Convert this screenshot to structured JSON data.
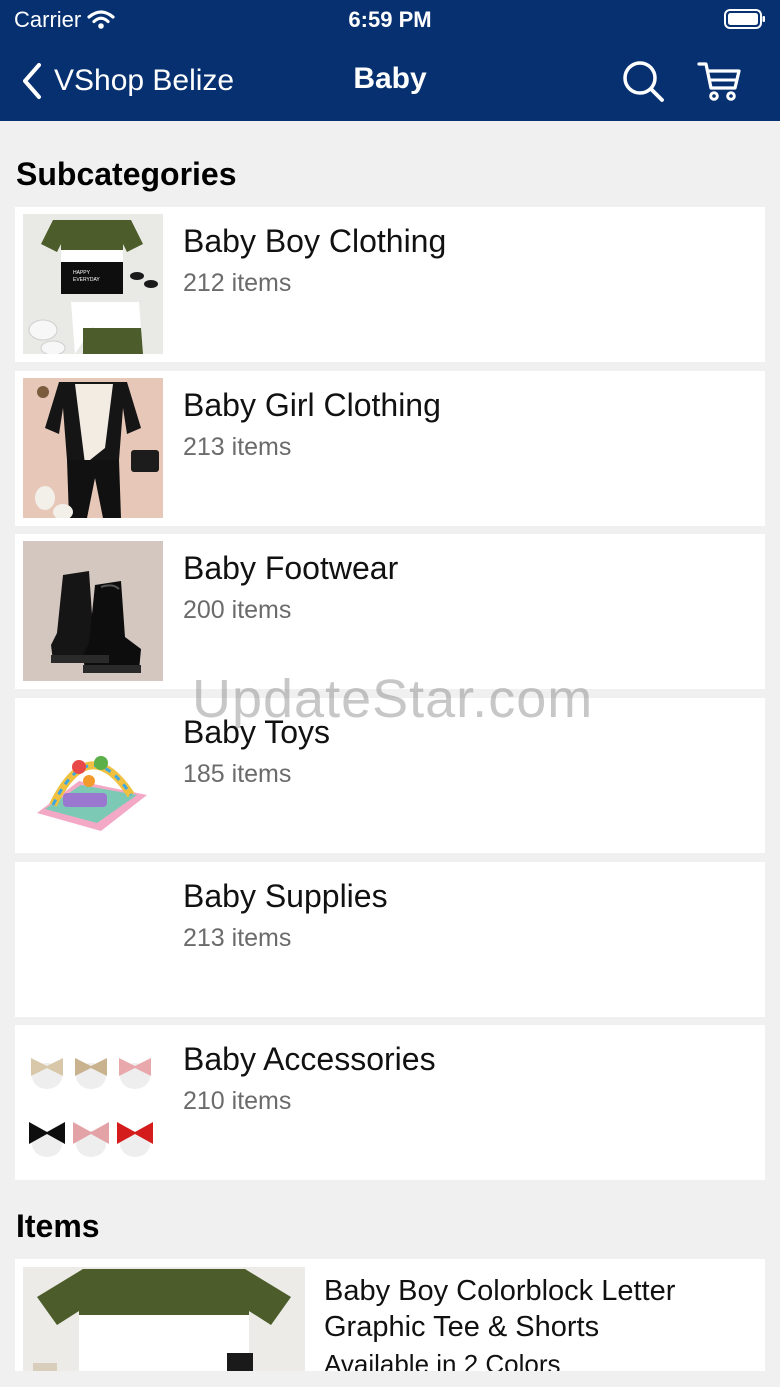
{
  "status_bar": {
    "carrier": "Carrier",
    "time": "6:59 PM"
  },
  "nav": {
    "back_label": "VShop Belize",
    "title": "Baby",
    "search_icon": "search-icon",
    "cart_icon": "cart-icon"
  },
  "sections": {
    "subcategories": "Subcategories",
    "items": "Items"
  },
  "subcategories": [
    {
      "name": "Baby Boy Clothing",
      "count": "212 items"
    },
    {
      "name": "Baby Girl Clothing",
      "count": "213 items"
    },
    {
      "name": "Baby Footwear",
      "count": "200 items"
    },
    {
      "name": "Baby Toys",
      "count": "185 items"
    },
    {
      "name": "Baby Supplies",
      "count": "213 items"
    },
    {
      "name": "Baby Accessories",
      "count": "210 items"
    }
  ],
  "items": [
    {
      "title": "Baby Boy Colorblock Letter Graphic Tee & Shorts",
      "subtitle": "Available in 2 Colors"
    }
  ],
  "watermark": "UpdateStar.com",
  "colors": {
    "header_bg": "#063070",
    "page_bg": "#f0f0f0",
    "card_bg": "#ffffff",
    "count_text": "#6b6b6b"
  }
}
